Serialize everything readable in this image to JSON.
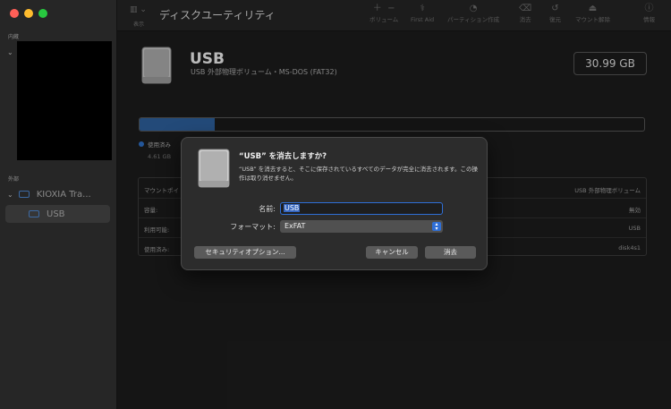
{
  "sidebar": {
    "internal_label": "内蔵",
    "external_label": "外部",
    "external_disk": "KIOXIA Tra...",
    "volume": "USB"
  },
  "toolbar": {
    "view_label": "表示",
    "title": "ディスクユーティリティ",
    "tools": [
      {
        "icon": "plus-minus-icon",
        "label": "ボリューム"
      },
      {
        "icon": "stethoscope-icon",
        "label": "First Aid"
      },
      {
        "icon": "pie-chart-icon",
        "label": "パーティション作成"
      },
      {
        "icon": "erase-icon",
        "label": "消去"
      },
      {
        "icon": "restore-icon",
        "label": "復元"
      },
      {
        "icon": "mount-icon",
        "label": "マウント解除"
      },
      {
        "icon": "info-icon",
        "label": "情報"
      }
    ]
  },
  "volume": {
    "name": "USB",
    "subtitle": "USB 外部物理ボリューム・MS-DOS (FAT32)",
    "capacity": "30.99 GB",
    "used_fraction": 0.149,
    "used_label": "使用済み",
    "used_size": "4.61 GB"
  },
  "info": {
    "rows": [
      {
        "key": "マウントポイ",
        "value": "USB 外部物理ボリューム"
      },
      {
        "key": "容量:",
        "value": "無効"
      },
      {
        "key": "利用可能:",
        "value": "USB"
      },
      {
        "key": "使用済み:",
        "value": "disk4s1"
      }
    ]
  },
  "dialog": {
    "title": "“USB” を消去しますか?",
    "message": "“USB” を消去すると、そこに保存されているすべてのデータが完全に消去されます。この操作は取り消せません。",
    "name_label": "名前:",
    "name_value": "USB",
    "format_label": "フォーマット:",
    "format_value": "ExFAT",
    "security_button": "セキュリティオプション...",
    "cancel_button": "キャンセル",
    "erase_button": "消去"
  }
}
